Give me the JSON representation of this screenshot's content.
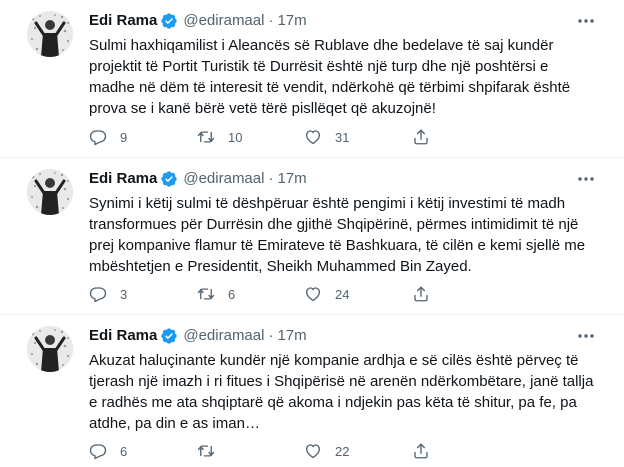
{
  "tweets": [
    {
      "author": {
        "name": "Edi Rama",
        "handle": "@ediramaal",
        "separator": "·",
        "time": "17m"
      },
      "text": "Sulmi haxhiqamilist i Aleancës së Rublave dhe bedelave të saj kundër\nprojektit të Portit Turistik të Durrësit është një turp dhe një poshtërsi e\nmadhe në dëm të interesit të vendit, ndërkohë që tërbimi shpifarak është\nprova se i kanë bërë vetë tërë pisllëqet që akuzojnë!",
      "replies": "9",
      "retweets": "10",
      "likes": "31"
    },
    {
      "author": {
        "name": "Edi Rama",
        "handle": "@ediramaal",
        "separator": "·",
        "time": "17m"
      },
      "text": "Synimi i këtij sulmi të dëshpëruar është pengimi i këtij investimi të madh\ntransformues për Durrësin dhe gjithë Shqipërinë, përmes intimidimit të një\nprej kompanive flamur të Emirateve të Bashkuara, të cilën e kemi sjellë me\nmbështetjen e Presidentit, Sheikh Muhammed Bin Zayed.",
      "replies": "3",
      "retweets": "6",
      "likes": "24"
    },
    {
      "author": {
        "name": "Edi Rama",
        "handle": "@ediramaal",
        "separator": "·",
        "time": "17m"
      },
      "text": "Akuzat haluçinante kundër një kompanie ardhja e së cilës është përveç të\ntjerash një imazh i ri fitues i Shqipërisë në arenën ndërkombëtare, janë tallja\ne radhës me ata shqiptarë që akoma i ndjekin pas këta të shitur, pa fe, pa\natdhe, pa din e as iman…",
      "replies": "6",
      "retweets": "",
      "likes": "22"
    }
  ],
  "colors": {
    "verified": "#1d9bf0",
    "muted": "#536471",
    "divider": "#eff3f4"
  },
  "icons": [
    "avatar-photo",
    "verified-badge-icon",
    "more-icon",
    "reply-icon",
    "retweet-icon",
    "like-icon",
    "share-icon"
  ]
}
